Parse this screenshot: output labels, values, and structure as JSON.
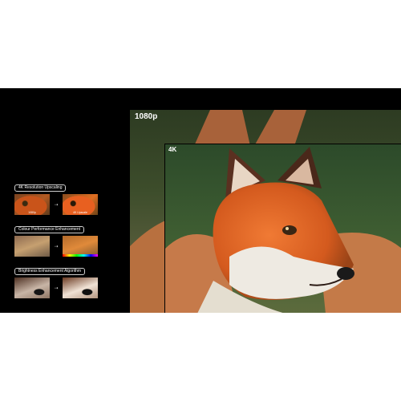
{
  "resolutions": {
    "outer_label": "1080p",
    "inner_label": "4K"
  },
  "features": [
    {
      "label": "4K Resolution Upscaling",
      "before_caption": "1080p",
      "after_caption": "4K Upscale"
    },
    {
      "label": "Colour Performance Enhancement",
      "before_caption": "",
      "after_caption": ""
    },
    {
      "label": "Brightness Enhancement Algorithm",
      "before_caption": "",
      "after_caption": ""
    }
  ],
  "icons": {
    "arrow": "arrow-right-icon"
  },
  "colors": {
    "background": "#000000",
    "fox_orange": "#e0662a",
    "grass": "#3f5e32"
  }
}
